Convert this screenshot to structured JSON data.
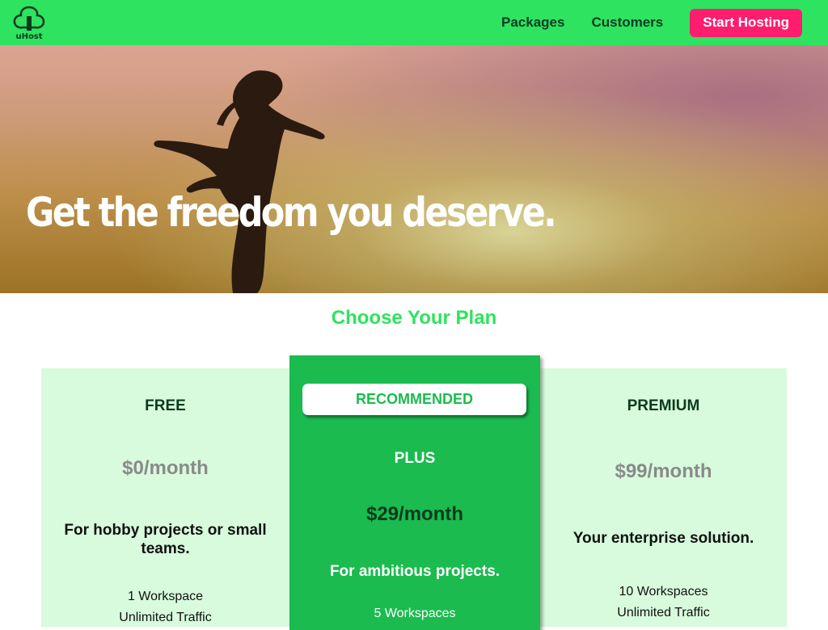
{
  "header": {
    "logo_text": "uHost",
    "nav": [
      {
        "label": "Packages"
      },
      {
        "label": "Customers"
      }
    ],
    "cta_label": "Start Hosting"
  },
  "hero": {
    "title": "Get the freedom you deserve."
  },
  "plans": {
    "title": "Choose Your Plan",
    "items": [
      {
        "name": "FREE",
        "price": "$0/month",
        "description": "For hobby projects or small teams.",
        "features": [
          "1 Workspace",
          "Unlimited Traffic"
        ]
      },
      {
        "badge": "RECOMMENDED",
        "name": "PLUS",
        "price": "$29/month",
        "description": "For ambitious projects.",
        "features": [
          "5 Workspaces"
        ]
      },
      {
        "name": "PREMIUM",
        "price": "$99/month",
        "description": "Your enterprise solution.",
        "features": [
          "10 Workspaces",
          "Unlimited Traffic"
        ]
      }
    ]
  },
  "colors": {
    "header_bg": "#2ee35f",
    "cta_bg": "#fe1d6e",
    "card_light_bg": "#d7fbdc",
    "card_highlight_bg": "#1bbb4f",
    "price_gray": "#8a8a8a"
  }
}
